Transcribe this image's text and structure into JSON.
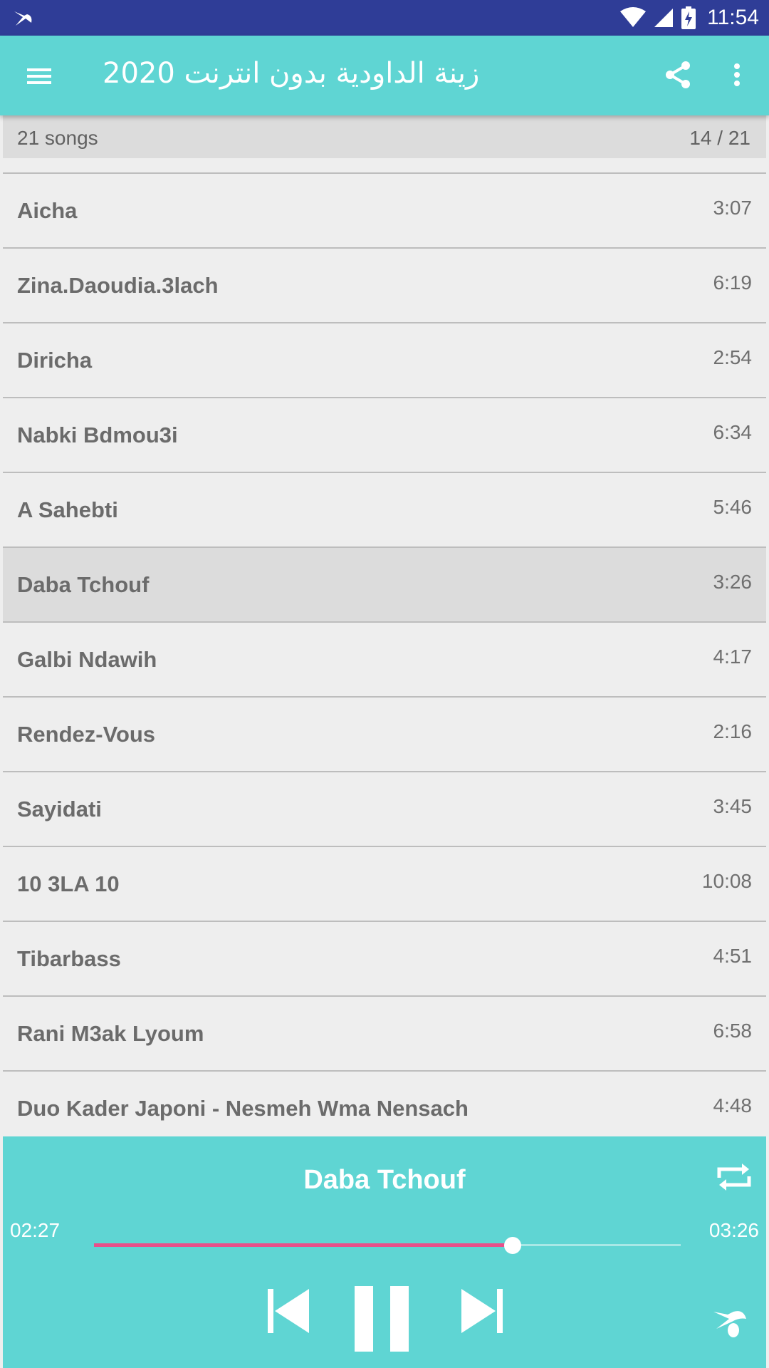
{
  "status_bar": {
    "time": "11:54"
  },
  "app_bar": {
    "title": "زينة الداودية بدون انترنت 2020"
  },
  "list_header": {
    "count": "21 songs",
    "position": "14 / 21"
  },
  "songs": [
    {
      "name": "Aicha",
      "duration": "3:07"
    },
    {
      "name": "Zina.Daoudia.3lach",
      "duration": "6:19"
    },
    {
      "name": "Diricha",
      "duration": "2:54"
    },
    {
      "name": "Nabki Bdmou3i",
      "duration": "6:34"
    },
    {
      "name": "A Sahebti",
      "duration": "5:46"
    },
    {
      "name": "Daba Tchouf",
      "duration": "3:26"
    },
    {
      "name": "Galbi Ndawih",
      "duration": "4:17"
    },
    {
      "name": "Rendez-Vous",
      "duration": "2:16"
    },
    {
      "name": "Sayidati",
      "duration": "3:45"
    },
    {
      "name": "10 3LA 10",
      "duration": "10:08"
    },
    {
      "name": "Tibarbass",
      "duration": "4:51"
    },
    {
      "name": "Rani M3ak Lyoum",
      "duration": "6:58"
    },
    {
      "name": "Duo Kader Japoni - Nesmeh Wma Nensach",
      "duration": "4:48"
    }
  ],
  "active_song_index": 5,
  "player": {
    "title": "Daba Tchouf",
    "elapsed": "02:27",
    "total": "03:26",
    "progress": 0.713
  },
  "colors": {
    "status_bar": "#2f3d97",
    "accent": "#5fd5d3",
    "progress": "#e8508a"
  },
  "icons": {
    "status_logo": "bird-logo-icon",
    "wifi": "wifi-icon",
    "signal": "signal-icon",
    "battery": "battery-charging-icon",
    "menu": "menu-icon",
    "share": "share-icon",
    "more": "more-vert-icon",
    "repeat": "repeat-icon",
    "previous": "skip-previous-icon",
    "pause": "pause-icon",
    "next": "skip-next-icon",
    "app_logo": "bird-logo-icon"
  }
}
